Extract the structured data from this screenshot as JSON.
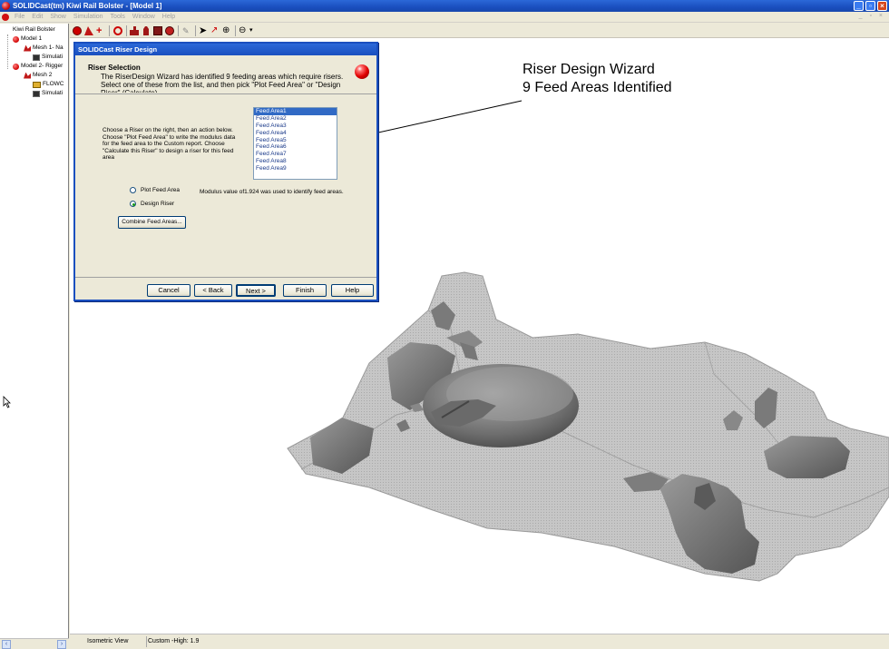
{
  "window": {
    "title": "SOLIDCast(tm) Kiwi Rail Bolster - [Model 1]"
  },
  "menu": {
    "items": [
      "File",
      "Edit",
      "Show",
      "Simulation",
      "Tools",
      "Window",
      "Help"
    ],
    "mdi_controls": "_ ▫ ×"
  },
  "tree": {
    "root": "Kiwi Rail Bolster",
    "model1": "Model 1",
    "mesh1": "Mesh 1- Na",
    "sim1": "Simulati",
    "model2": "Model 2- Rigger",
    "mesh2": "Mesh 2",
    "flow": "FLOWC",
    "sim2": "Simulati"
  },
  "dialog": {
    "title": "SOLIDCast Riser Design",
    "heading": "Riser Selection",
    "description": "The RiserDesign Wizard has identified 9 feeding areas which require risers. Select one of these from the list, and then pick \"Plot Feed Area\" or \"Design Riser\" (Calculate).",
    "instructions": "Choose a Riser on the right, then an action below. Choose \"Plot Feed Area\" to write the modulus data for the feed area to the Custom report. Choose \"Calculate this Riser\" to design a riser for this feed area",
    "feed_areas": [
      "Feed Area1",
      "Feed Area2",
      "Feed Area3",
      "Feed Area4",
      "Feed Area5",
      "Feed Area6",
      "Feed Area7",
      "Feed Area8",
      "Feed Area9"
    ],
    "selected_feed_area": "Feed Area1",
    "radio_plot": "Plot Feed Area",
    "radio_design": "Design Riser",
    "selected_radio": "Design Riser",
    "modulus_text": "Modulus value of1.924 was used to identify feed areas.",
    "combine_button": "Combine Feed Areas...",
    "cancel_button": "Cancel",
    "back_button": "< Back",
    "next_button": "Next >",
    "finish_button": "Finish",
    "help_button": "Help"
  },
  "annotation": {
    "line1": "Riser Design Wizard",
    "line2": "9 Feed Areas Identified"
  },
  "status": {
    "view": "Isometric View",
    "quality": "Custom -High: 1.9"
  },
  "colors": {
    "titlebar": "#1a4fbf",
    "dialog_face": "#ece9d8",
    "selection": "#316ac5",
    "casting_gray": "#bdbdbd",
    "feeder_dark": "#6a6a6a"
  }
}
